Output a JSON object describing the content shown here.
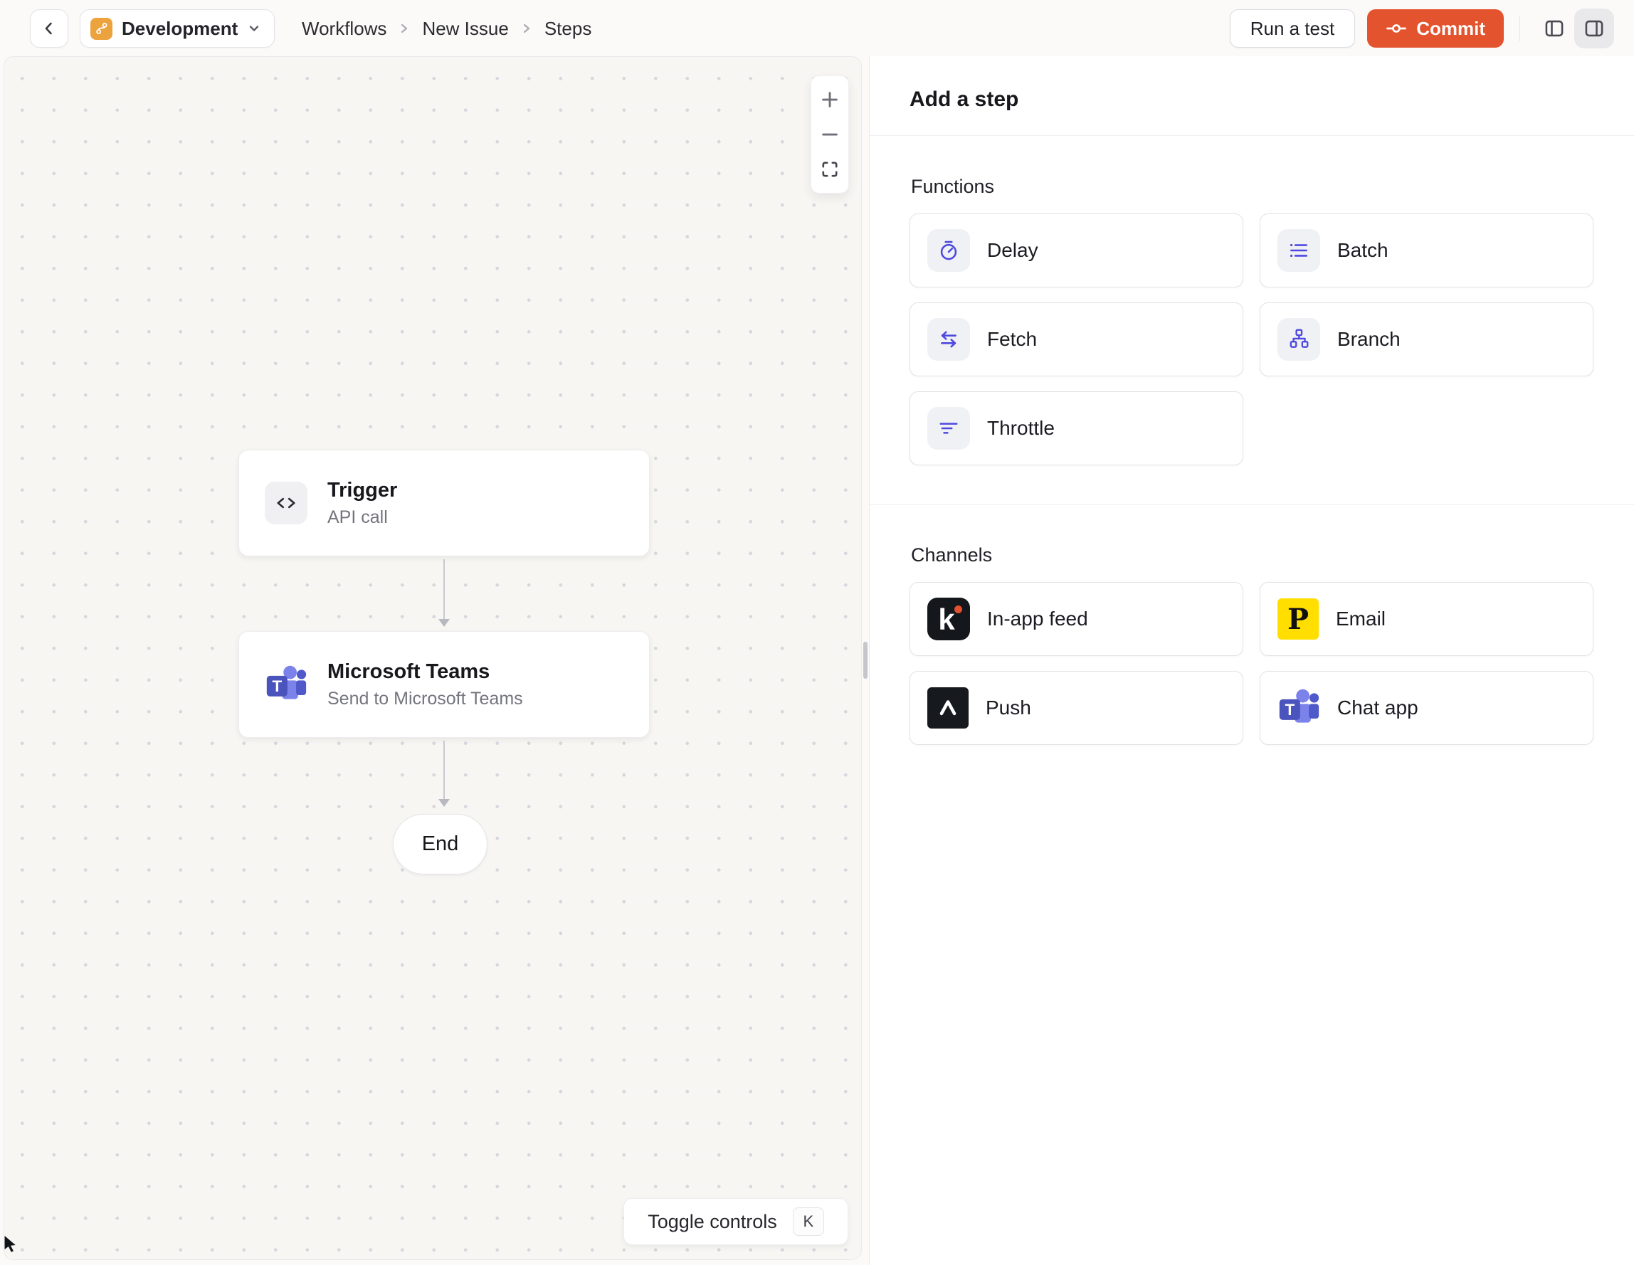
{
  "header": {
    "environment": {
      "icon": "git-branch-icon",
      "label": "Development"
    },
    "breadcrumb": {
      "items": [
        "Workflows",
        "New Issue",
        "Steps"
      ]
    },
    "actions": {
      "run_test": "Run a test",
      "commit": "Commit"
    },
    "panel_toggles": [
      "left-panel-icon",
      "right-panel-icon"
    ]
  },
  "canvas": {
    "zoom_controls": {
      "items": [
        "zoom-in",
        "zoom-out",
        "fit-view"
      ]
    },
    "nodes": {
      "trigger": {
        "icon": "code-icon",
        "title": "Trigger",
        "subtitle": "API call"
      },
      "teams": {
        "icon": "microsoft-teams-logo",
        "title": "Microsoft Teams",
        "subtitle": "Send to Microsoft Teams"
      },
      "end": {
        "label": "End"
      }
    },
    "toggle_controls": {
      "label": "Toggle controls",
      "shortcut": "K"
    }
  },
  "panel": {
    "title": "Add a step",
    "functions": {
      "label": "Functions",
      "items": [
        {
          "label": "Delay",
          "icon": "stopwatch-icon"
        },
        {
          "label": "Batch",
          "icon": "list-icon"
        },
        {
          "label": "Fetch",
          "icon": "swap-arrows-icon"
        },
        {
          "label": "Branch",
          "icon": "hierarchy-icon"
        },
        {
          "label": "Throttle",
          "icon": "filter-lines-icon"
        }
      ]
    },
    "channels": {
      "label": "Channels",
      "items": [
        {
          "label": "In-app feed",
          "icon": "knock-logo"
        },
        {
          "label": "Email",
          "icon": "postmark-logo"
        },
        {
          "label": "Push",
          "icon": "expo-logo"
        },
        {
          "label": "Chat app",
          "icon": "microsoft-teams-logo"
        }
      ]
    }
  },
  "logos": {
    "knock": "k",
    "postmark": "P",
    "teams": "T"
  },
  "colors": {
    "commit_orange": "#E3542E",
    "environment_orange": "#ECA23D",
    "accent_indigo": "#4E49DE",
    "knock_black": "#14171C",
    "postmark_yellow": "#FFDE00",
    "teams_purple": "#4B53BC",
    "canvas_bg": "#F7F6F3"
  }
}
